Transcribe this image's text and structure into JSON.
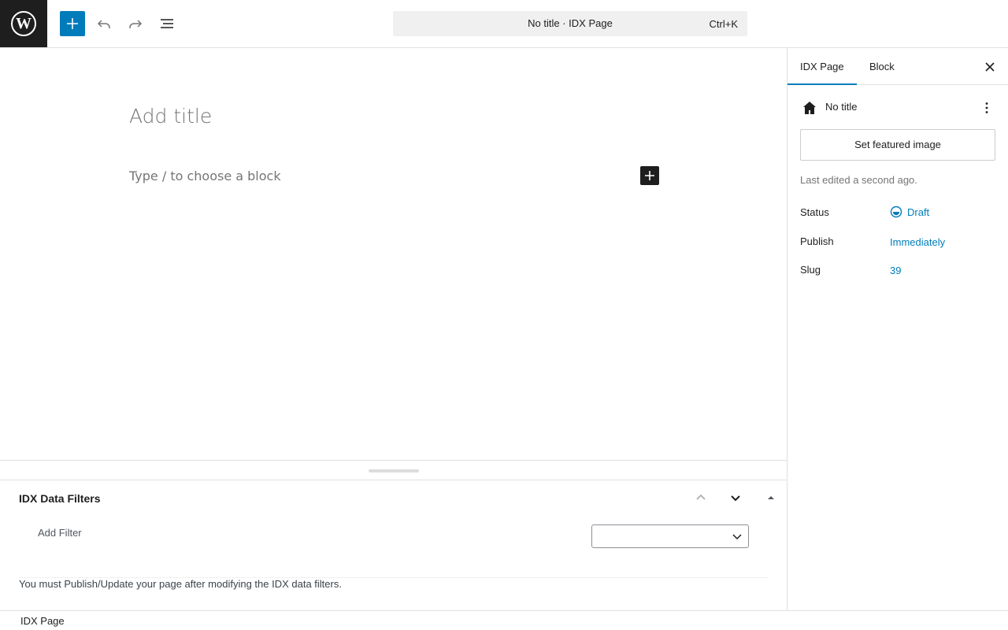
{
  "header": {
    "logo_icon": "wordpress-logo-icon",
    "logo_letter": "W",
    "inserter_icon": "plus-icon",
    "undo_icon": "undo-icon",
    "redo_icon": "redo-icon",
    "outline_icon": "document-overview-icon",
    "command_title": "No title · IDX Page",
    "command_shortcut": "Ctrl+K",
    "accent_color": "#007cba"
  },
  "editor": {
    "title_placeholder": "Add title",
    "block_placeholder": "Type / to choose a block",
    "add_block_icon": "plus-icon"
  },
  "metabox": {
    "title": "IDX Data Filters",
    "add_filter_label": "Add Filter",
    "filter_select_value": "",
    "note": "You must Publish/Update your page after modifying the IDX data filters."
  },
  "sidebar": {
    "tabs": [
      {
        "label": "IDX Page",
        "active": true
      },
      {
        "label": "Block",
        "active": false
      }
    ],
    "close_icon": "close-icon",
    "post_icon": "home-icon",
    "post_title": "No title",
    "more_icon": "more-vertical-icon",
    "featured_image_label": "Set featured image",
    "last_edited": "Last edited a second ago.",
    "rows": [
      {
        "label": "Status",
        "value": "Draft",
        "icon": "draft-status-icon"
      },
      {
        "label": "Publish",
        "value": "Immediately"
      },
      {
        "label": "Slug",
        "value": "39"
      }
    ]
  },
  "footer": {
    "label": "IDX Page"
  }
}
